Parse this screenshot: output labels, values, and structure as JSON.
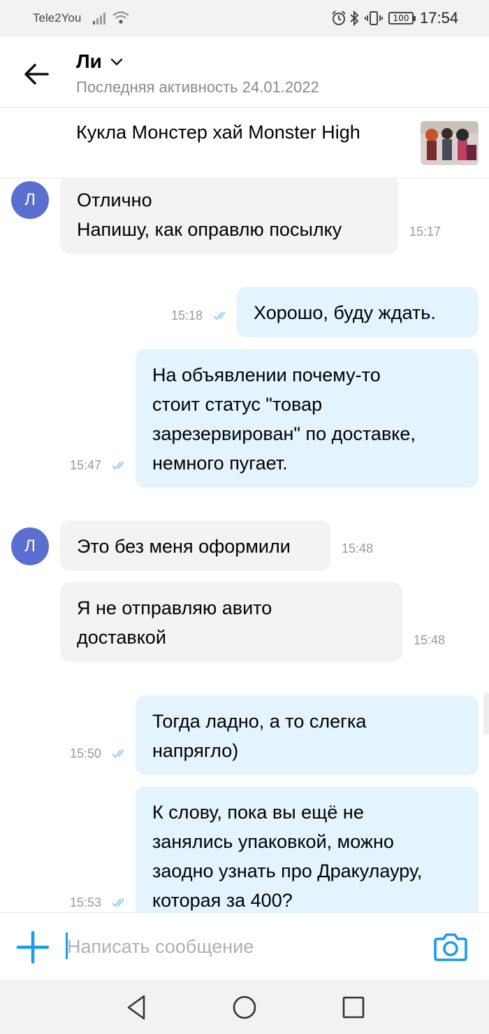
{
  "status_bar": {
    "carrier": "Tele2You",
    "battery": "100",
    "time": "17:54",
    "icons": [
      "signal-icon",
      "wifi-icon",
      "alarm-icon",
      "bluetooth-icon",
      "vibrate-icon",
      "battery-icon"
    ]
  },
  "header": {
    "back_icon": "arrow-left-icon",
    "name": "Ли",
    "name_icon": "chevron-down-icon",
    "last_seen": "Последняя активность 24.01.2022"
  },
  "listing": {
    "title": "Кукла Монстер хай Monster High",
    "thumbnail": "doll-photo"
  },
  "messages": [
    {
      "direction": "in",
      "avatar": "Л",
      "lines": [
        "Отлично",
        "Напишу, как оправлю посылку"
      ],
      "time": "15:17"
    },
    {
      "direction": "out",
      "lines": [
        "Хорошо, буду ждать."
      ],
      "time": "15:18",
      "status": "read"
    },
    {
      "direction": "out",
      "lines": [
        "На объявлении почему-то",
        "стоит статус \"товар",
        "зарезервирован\" по доставке,",
        "немного пугает."
      ],
      "time": "15:47",
      "status": "read"
    },
    {
      "direction": "in",
      "avatar": "Л",
      "lines": [
        "Это без меня оформили"
      ],
      "time": "15:48"
    },
    {
      "direction": "in",
      "lines": [
        "Я не отправляю авито",
        "доставкой"
      ],
      "time": "15:48"
    },
    {
      "direction": "out",
      "lines": [
        "Тогда ладно, а то слегка",
        "напрягло)"
      ],
      "time": "15:50",
      "status": "read"
    },
    {
      "direction": "out",
      "lines": [
        "К слову, пока вы ещё не",
        "занялись упаковкой, можно",
        "заодно узнать про Дракулауру,",
        "которая за 400?"
      ],
      "time": "15:53",
      "status": "read"
    }
  ],
  "composer": {
    "add_icon": "plus-icon",
    "placeholder": "Написать сообщение",
    "value": "",
    "camera_icon": "camera-icon"
  },
  "nav": {
    "icons": [
      "back-triangle-icon",
      "home-circle-icon",
      "recents-square-icon"
    ]
  },
  "colors": {
    "accent": "#1a9af0",
    "outgoing_bubble": "#e3f4fe",
    "incoming_bubble": "#f3f3f3",
    "avatar": "#5a6fd0",
    "read_ticks": "#8ecdf2"
  }
}
